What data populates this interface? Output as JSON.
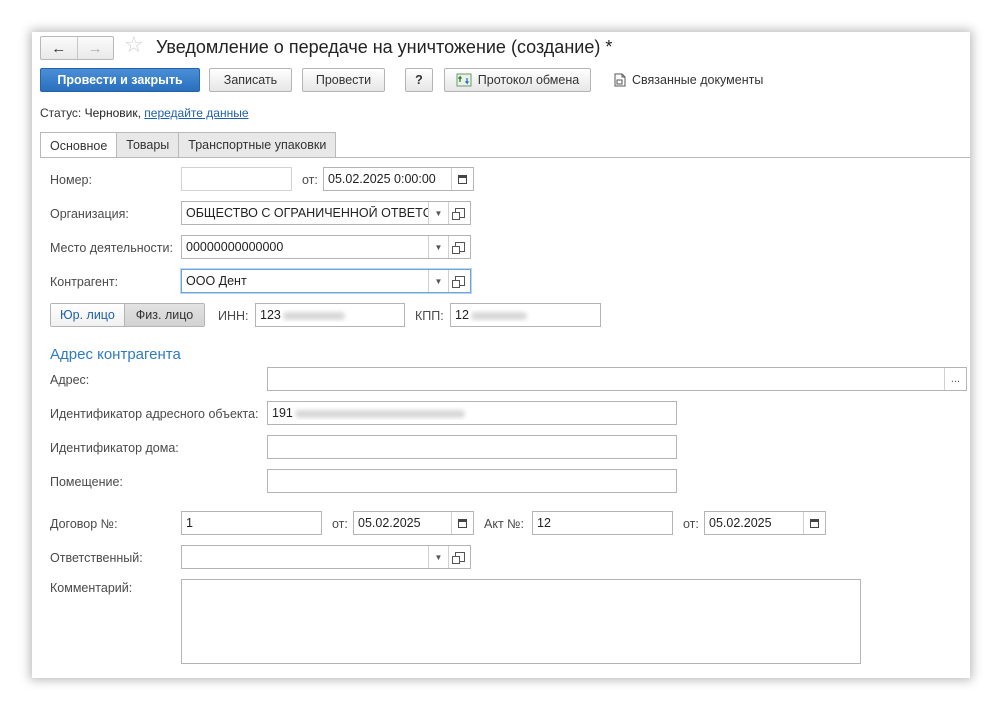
{
  "window": {
    "title": "Уведомление о передаче на уничтожение (создание) *",
    "nav_back": "←",
    "nav_forward": "→",
    "favorite_icon": "star-icon"
  },
  "toolbar": {
    "post_close": "Провести и закрыть",
    "save": "Записать",
    "post": "Провести",
    "help": "?",
    "exchange_log": "Протокол обмена",
    "related_docs": "Связанные документы"
  },
  "status": {
    "label": "Статус:",
    "value": "Черновик,",
    "link": "передайте данные"
  },
  "tabs": [
    "Основное",
    "Товары",
    "Транспортные упаковки"
  ],
  "form": {
    "number_label": "Номер:",
    "number_value": "",
    "date_from_label": "от:",
    "date_value": "05.02.2025  0:00:00",
    "org_label": "Организация:",
    "org_value": "ОБЩЕСТВО С ОГРАНИЧЕННОЙ ОТВЕТСТВЕННОСТЬЮ",
    "place_label": "Место деятельности:",
    "place_value": "00000000000000",
    "counterparty_label": "Контрагент:",
    "counterparty_value": "ООО Дент",
    "legal_entity": "Юр. лицо",
    "individual": "Физ. лицо",
    "inn_label": "ИНН:",
    "inn_value": "123",
    "kpp_label": "КПП:",
    "kpp_value": "12"
  },
  "address": {
    "section_title": "Адрес контрагента",
    "address_label": "Адрес:",
    "address_value": "",
    "address_btn": "...",
    "object_id_label": "Идентификатор адресного объекта:",
    "object_id_value": "191",
    "house_id_label": "Идентификатор дома:",
    "house_id_value": "",
    "room_label": "Помещение:",
    "room_value": ""
  },
  "contract": {
    "contract_label": "Договор №:",
    "contract_value": "1",
    "contract_from_label": "от:",
    "contract_date": "05.02.2025",
    "act_label": "Акт №:",
    "act_value": "12",
    "act_from_label": "от:",
    "act_date": "05.02.2025"
  },
  "responsible": {
    "label": "Ответственный:",
    "value": ""
  },
  "comment": {
    "label": "Комментарий:",
    "value": ""
  }
}
